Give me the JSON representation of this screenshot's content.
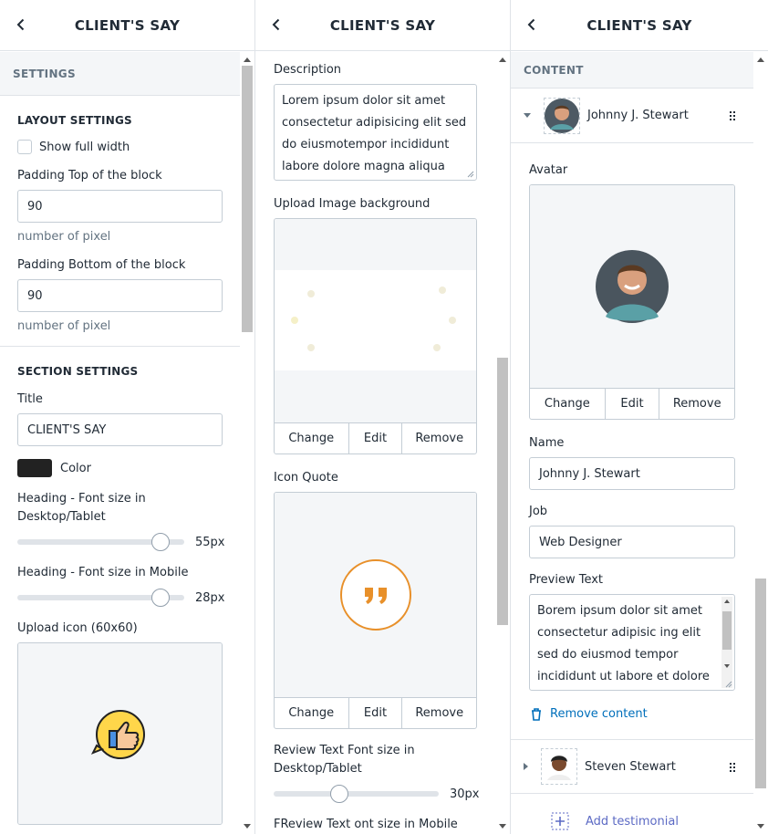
{
  "panel1": {
    "title": "CLIENT'S SAY",
    "settings_label": "SETTINGS",
    "layout_title": "LAYOUT SETTINGS",
    "full_width_label": "Show full width",
    "padding_top_label": "Padding Top of the block",
    "padding_top_value": "90",
    "padding_top_help": "number of pixel",
    "padding_bottom_label": "Padding Bottom of the block",
    "padding_bottom_value": "90",
    "padding_bottom_help": "number of pixel",
    "section_title": "SECTION SETTINGS",
    "title_label": "Title",
    "title_value": "CLIENT'S SAY",
    "color_label": "Color",
    "color_value": "#222222",
    "heading_desktop_label": "Heading - Font size in Desktop/Tablet",
    "heading_desktop_value": "55px",
    "heading_desktop_level": 0.86,
    "heading_mobile_label": "Heading - Font size in Mobile",
    "heading_mobile_value": "28px",
    "heading_mobile_level": 0.86,
    "upload_icon_label": "Upload icon (60x60)",
    "upload_icon_name": "thumbs-up-icon"
  },
  "panel2": {
    "title": "CLIENT'S SAY",
    "description_label": "Description",
    "description_text": "Lorem ipsum dolor sit amet consectetur adipisicing elit sed do eiusmotempor incididunt labore dolore magna aliqua",
    "bg_label": "Upload Image background",
    "change": "Change",
    "edit": "Edit",
    "remove": "Remove",
    "quote_label": "Icon Quote",
    "quote_icon_color": "#e8902a",
    "review_desktop_label": "Review Text Font size in Desktop/Tablet",
    "review_desktop_value": "30px",
    "review_desktop_level": 0.4,
    "review_mobile_label": "FReview Text ont size in Mobile"
  },
  "panel3": {
    "title": "CLIENT'S SAY",
    "content_label": "CONTENT",
    "item1_name": "Johnny J. Stewart",
    "avatar_label": "Avatar",
    "change": "Change",
    "edit": "Edit",
    "remove": "Remove",
    "name_label": "Name",
    "name_value": "Johnny J. Stewart",
    "job_label": "Job",
    "job_value": "Web Designer",
    "preview_label": "Preview Text",
    "preview_text": "Borem ipsum dolor sit amet consectetur adipisic ing elit sed do eiusmod tempor incididunt ut labore et dolore",
    "remove_content": "Remove content",
    "item2_name": "Steven Stewart",
    "add_testimonial": "Add testimonial",
    "link_color": "#006fbb"
  }
}
